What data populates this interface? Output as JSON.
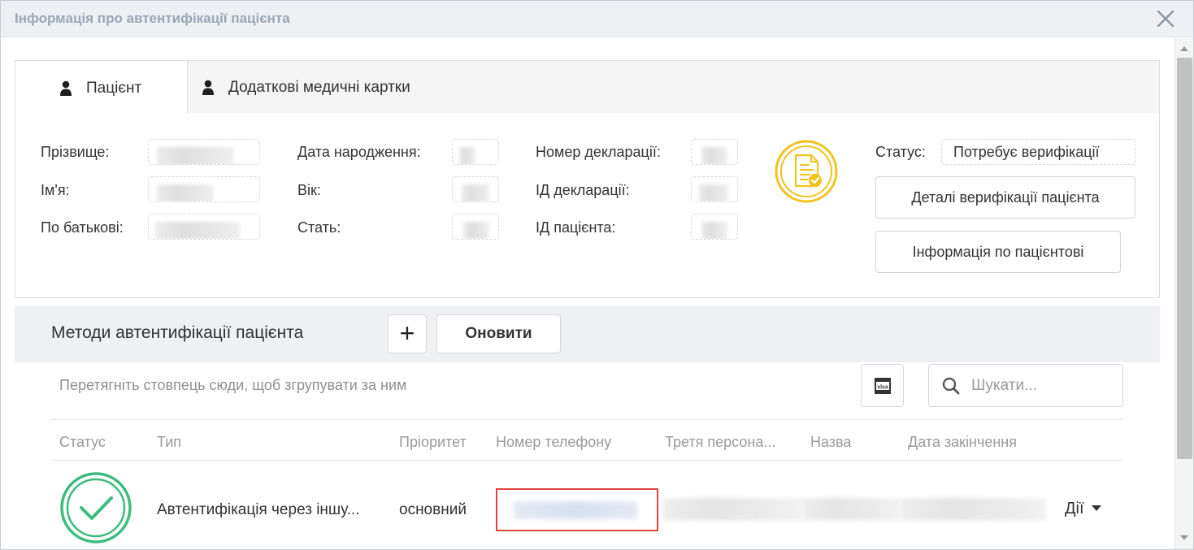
{
  "window": {
    "title": "Інформація про автентифікації пацієнта"
  },
  "tabs": [
    {
      "label": "Пацієнт",
      "active": true
    },
    {
      "label": "Додаткові медичні картки",
      "active": false
    }
  ],
  "patient": {
    "surname_label": "Прізвище:",
    "name_label": "Ім'я:",
    "patronymic_label": "По батькові:",
    "dob_label": "Дата народження:",
    "age_label": "Вік:",
    "sex_label": "Стать:",
    "declaration_number_label": "Номер декларації:",
    "declaration_id_label": "ІД декларації:",
    "patient_id_label": "ІД пацієнта:",
    "status_label": "Статус:",
    "status_value": "Потребує верифікації",
    "verification_details_button": "Деталі верифікації пацієнта",
    "patient_info_button": "Інформація по пацієнтові"
  },
  "methods": {
    "title": "Методи автентифікації пацієнта",
    "add_button": "+",
    "refresh_button": "Оновити",
    "group_hint": "Перетягніть стовпець сюди, щоб згрупувати за ним",
    "export_icon": "xlsx-export-icon",
    "search_placeholder": "Шукати...",
    "columns": [
      "Статус",
      "Тип",
      "Пріоритет",
      "Номер телефону",
      "Третя персона...",
      "Назва",
      "Дата закінчення"
    ],
    "rows": [
      {
        "status_icon": "check-circle-icon",
        "type": "Автентифікація через іншу...",
        "priority": "основний",
        "actions": "Дії"
      }
    ]
  },
  "colors": {
    "accent_green": "#3dbb7e",
    "highlight_red": "#e0443e",
    "doc_yellow": "#f2c21b",
    "title_gray": "#9aa6b6"
  }
}
